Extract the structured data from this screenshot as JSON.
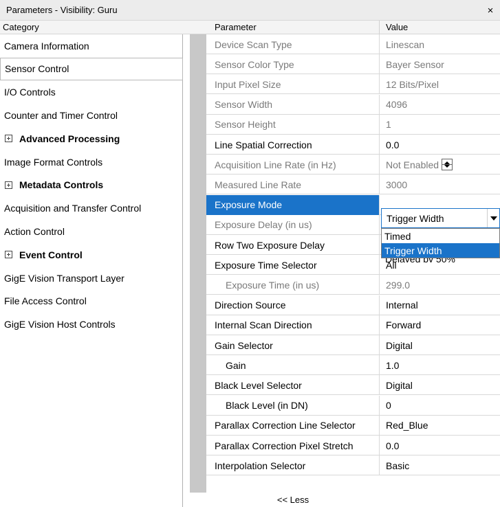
{
  "window": {
    "title": "Parameters - Visibility: Guru",
    "close_glyph": "×"
  },
  "headers": {
    "category": "Category",
    "parameter": "Parameter",
    "value": "Value"
  },
  "categories": [
    {
      "label": "Camera Information",
      "group": false,
      "selected": false
    },
    {
      "label": "Sensor Control",
      "group": false,
      "selected": true
    },
    {
      "label": "I/O Controls",
      "group": false,
      "selected": false
    },
    {
      "label": "Counter and Timer Control",
      "group": false,
      "selected": false
    },
    {
      "label": "Advanced Processing",
      "group": true,
      "selected": false
    },
    {
      "label": "Image Format Controls",
      "group": false,
      "selected": false
    },
    {
      "label": "Metadata Controls",
      "group": true,
      "selected": false
    },
    {
      "label": "Acquisition and Transfer Control",
      "group": false,
      "selected": false
    },
    {
      "label": "Action Control",
      "group": false,
      "selected": false
    },
    {
      "label": "Event Control",
      "group": true,
      "selected": false
    },
    {
      "label": "GigE Vision Transport Layer",
      "group": false,
      "selected": false
    },
    {
      "label": "File Access Control",
      "group": false,
      "selected": false
    },
    {
      "label": "GigE Vision Host Controls",
      "group": false,
      "selected": false
    }
  ],
  "parameters": [
    {
      "name": "Device Scan Type",
      "value": "Linescan",
      "disabled": true
    },
    {
      "name": "Sensor Color Type",
      "value": "Bayer Sensor",
      "disabled": true
    },
    {
      "name": "Input Pixel Size",
      "value": "12 Bits/Pixel",
      "disabled": true
    },
    {
      "name": "Sensor Width",
      "value": "4096",
      "disabled": true
    },
    {
      "name": "Sensor Height",
      "value": "1",
      "disabled": true
    },
    {
      "name": "Line Spatial Correction",
      "value": "0.0",
      "disabled": false
    },
    {
      "name": "Acquisition Line Rate (in Hz)",
      "value": "Not Enabled",
      "disabled": true,
      "spinner": true
    },
    {
      "name": "Measured Line Rate",
      "value": "3000",
      "disabled": true
    },
    {
      "name": "Exposure Mode",
      "value": "",
      "disabled": false,
      "selected": true
    },
    {
      "name": "Exposure Delay (in us)",
      "value": "",
      "disabled": true
    },
    {
      "name": "Row Two Exposure Delay",
      "value": "",
      "disabled": false
    },
    {
      "name": "Exposure Time Selector",
      "value": "All",
      "disabled": false
    },
    {
      "name": "Exposure Time (in us)",
      "value": "299.0",
      "disabled": true,
      "indent": true
    },
    {
      "name": "Direction Source",
      "value": "Internal",
      "disabled": false
    },
    {
      "name": "Internal Scan Direction",
      "value": "Forward",
      "disabled": false
    },
    {
      "name": "Gain Selector",
      "value": "Digital",
      "disabled": false
    },
    {
      "name": "Gain",
      "value": "1.0",
      "disabled": false,
      "indent": true
    },
    {
      "name": "Black Level Selector",
      "value": "Digital",
      "disabled": false
    },
    {
      "name": "Black Level (in DN)",
      "value": "0",
      "disabled": false,
      "indent": true
    },
    {
      "name": "Parallax Correction Line Selector",
      "value": "Red_Blue",
      "disabled": false
    },
    {
      "name": "Parallax Correction Pixel Stretch",
      "value": "0.0",
      "disabled": false
    },
    {
      "name": "Interpolation Selector",
      "value": "Basic",
      "disabled": false
    }
  ],
  "exposure_mode_combo": {
    "value": "Trigger Width",
    "options": [
      "Timed",
      "Trigger Width"
    ],
    "highlighted": "Trigger Width"
  },
  "row_two_obscured_value": "Delayed by 50%",
  "less_link": "<< Less",
  "colors": {
    "selection": "#1a73c9",
    "disabled_text": "#7a7a7a",
    "gutter": "#c8c8c8"
  }
}
